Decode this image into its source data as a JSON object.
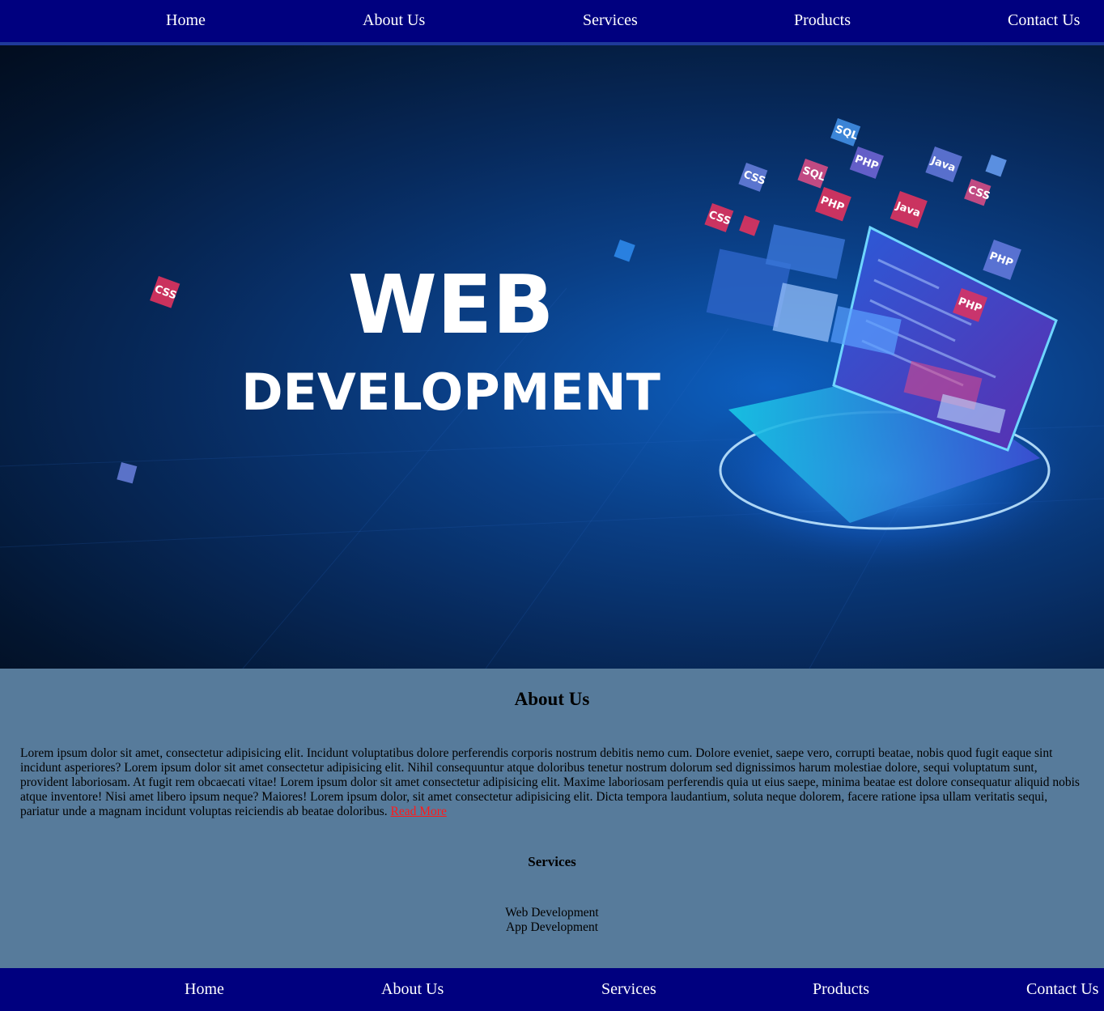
{
  "nav": {
    "items": [
      "Home",
      "About Us",
      "Services",
      "Products",
      "Contact Us"
    ]
  },
  "hero": {
    "title_line1": "WEB",
    "title_line2": "DEVELOPMENT",
    "tags": [
      "SQL",
      "PHP",
      "Java",
      "CSS",
      "SQL",
      "PHP",
      "Java",
      "CSS",
      "PHP",
      "CSS",
      "PHP",
      "CSS",
      "PHP",
      "CSS"
    ]
  },
  "about": {
    "heading": "About Us",
    "body": "Lorem ipsum dolor sit amet, consectetur adipisicing elit. Incidunt voluptatibus dolore perferendis corporis nostrum debitis nemo cum. Dolore eveniet, saepe vero, corrupti beatae, nobis quod fugit eaque sint incidunt asperiores? Lorem ipsum dolor sit amet consectetur adipisicing elit. Nihil consequuntur atque doloribus tenetur nostrum dolorum sed dignissimos harum molestiae dolore, sequi voluptatum sunt, provident laboriosam. At fugit rem obcaecati vitae! Lorem ipsum dolor sit amet consectetur adipisicing elit. Maxime laboriosam perferendis quia ut eius saepe, minima beatae est dolore consequatur aliquid nobis atque inventore! Nisi amet libero ipsum neque? Maiores! Lorem ipsum dolor, sit amet consectetur adipisicing elit. Dicta tempora laudantium, soluta neque dolorem, facere ratione ipsa ullam veritatis sequi, pariatur unde a magnam incidunt voluptas reiciendis ab beatae doloribus.",
    "read_more": "Read More"
  },
  "services": {
    "heading": "Services",
    "items": [
      "Web Development",
      "App Development"
    ]
  },
  "footer_nav": {
    "items": [
      "Home",
      "About Us",
      "Services",
      "Products",
      "Contact Us"
    ]
  },
  "colors": {
    "nav_bg": "#00007f",
    "content_bg": "#577b9b",
    "link_red": "#ff1a1a"
  }
}
